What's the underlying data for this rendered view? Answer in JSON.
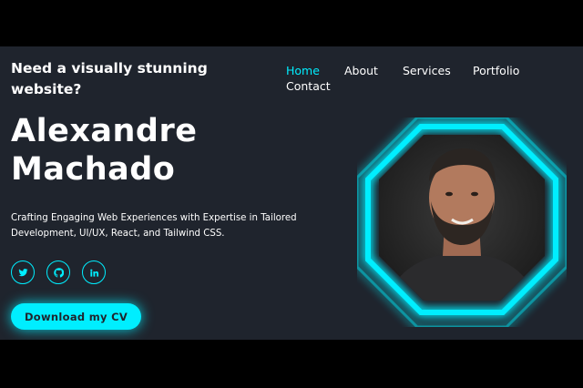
{
  "header": {
    "tagline": "Need a visually stunning website?"
  },
  "nav": {
    "items": [
      {
        "label": "Home",
        "active": true
      },
      {
        "label": "About"
      },
      {
        "label": "Services"
      },
      {
        "label": "Portfolio"
      },
      {
        "label": "Contact"
      }
    ]
  },
  "hero": {
    "name_line1": "Alexandre",
    "name_line2": "Machado",
    "intro": "Crafting Engaging Web Experiences with Expertise in Tailored Development, UI/UX, React, and Tailwind CSS.",
    "socials": [
      {
        "icon": "twitter-icon"
      },
      {
        "icon": "github-icon"
      },
      {
        "icon": "linkedin-icon"
      }
    ],
    "cv_button": "Download my CV"
  },
  "colors": {
    "accent": "#0ef",
    "background": "#1f242d",
    "text": "#ffffff"
  }
}
